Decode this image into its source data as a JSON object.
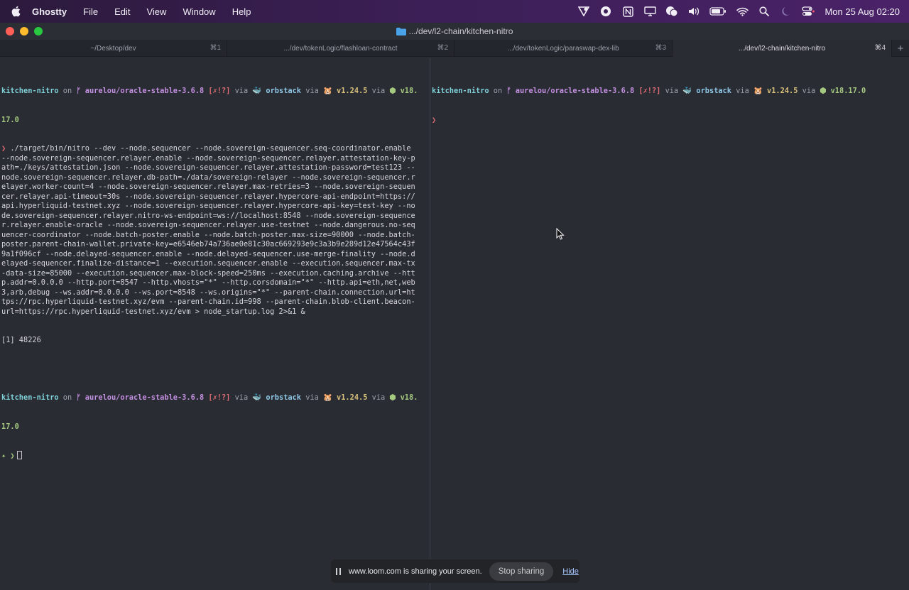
{
  "menubar": {
    "app": "Ghostty",
    "items": [
      "File",
      "Edit",
      "View",
      "Window",
      "Help"
    ],
    "status_icons": [
      "vpn-icon",
      "record-icon",
      "notion-icon",
      "display-icon",
      "chat-icon",
      "volume-icon",
      "battery-icon",
      "wifi-icon",
      "search-icon",
      "focus-moon-icon",
      "control-center-icon"
    ],
    "clock": "Mon 25 Aug  02:20"
  },
  "window": {
    "title": ".../dev/l2-chain/kitchen-nitro",
    "tabs": [
      {
        "label": "~/Desktop/dev",
        "shortcut": "⌘1"
      },
      {
        "label": ".../dev/tokenLogic/flashloan-contract",
        "shortcut": "⌘2"
      },
      {
        "label": ".../dev/tokenLogic/paraswap-dex-lib",
        "shortcut": "⌘3"
      },
      {
        "label": ".../dev/l2-chain/kitchen-nitro",
        "shortcut": "⌘4"
      }
    ],
    "add_tab": "+"
  },
  "left_pane": {
    "prompt1": {
      "dir": "kitchen-nitro",
      "on": " on ",
      "branch": "ᚠ aurelou/oracle-stable-3.6.8",
      "status": " [✗!?]",
      "via1": " via ",
      "tool1": "🐳 orbstack",
      "via2": " via ",
      "tool2": "🐹 v1.24.5",
      "via3": " via ",
      "node": "⬢ v18.",
      "node_wrap": "17.0"
    },
    "command_lines": [
      "❯ ./target/bin/nitro --dev --node.sequencer --node.sovereign-sequencer.seq-coordinator.enable",
      "--node.sovereign-sequencer.relayer.enable --node.sovereign-sequencer.relayer.attestation-key-p",
      "ath=./keys/attestation.json --node.sovereign-sequencer.relayer.attestation-password=test123 --",
      "node.sovereign-sequencer.relayer.db-path=./data/sovereign-relayer --node.sovereign-sequencer.r",
      "elayer.worker-count=4 --node.sovereign-sequencer.relayer.max-retries=3 --node.sovereign-sequen",
      "cer.relayer.api-timeout=30s --node.sovereign-sequencer.relayer.hypercore-api-endpoint=https://",
      "api.hyperliquid-testnet.xyz --node.sovereign-sequencer.relayer.hypercore-api-key=test-key --no",
      "de.sovereign-sequencer.relayer.nitro-ws-endpoint=ws://localhost:8548 --node.sovereign-sequence",
      "r.relayer.enable-oracle --node.sovereign-sequencer.relayer.use-testnet --node.dangerous.no-seq",
      "uencer-coordinator --node.batch-poster.enable --node.batch-poster.max-size=90000 --node.batch-",
      "poster.parent-chain-wallet.private-key=e6546eb74a736ae0e81c30ac669293e9c3a3b9e289d12e47564c43f",
      "9a1f096cf --node.delayed-sequencer.enable --node.delayed-sequencer.use-merge-finality --node.d",
      "elayed-sequencer.finalize-distance=1 --execution.sequencer.enable --execution.sequencer.max-tx",
      "-data-size=85000 --execution.sequencer.max-block-speed=250ms --execution.caching.archive --htt",
      "p.addr=0.0.0.0 --http.port=8547 --http.vhosts=\"*\" --http.corsdomain=\"*\" --http.api=eth,net,web",
      "3,arb,debug --ws.addr=0.0.0.0 --ws.port=8548 --ws.origins=\"*\" --parent-chain.connection.url=ht",
      "tps://rpc.hyperliquid-testnet.xyz/evm --parent-chain.id=998 --parent-chain.blob-client.beacon-",
      "url=https://rpc.hyperliquid-testnet.xyz/evm > node_startup.log 2>&1 &"
    ],
    "job_line": "[1] 48226",
    "final_prompt": "✦ ❯"
  },
  "right_pane": {
    "prompt": {
      "dir": "kitchen-nitro",
      "on": " on ",
      "branch": "ᚠ aurelou/oracle-stable-3.6.8",
      "status": " [✗!?]",
      "via1": " via ",
      "tool1": "🐳 orbstack",
      "via2": " via ",
      "tool2": "🐹 v1.24.5",
      "via3": " via ",
      "node": "⬢ v18.17.0"
    },
    "prompt_char": "❯"
  },
  "loom": {
    "message": "www.loom.com is sharing your screen.",
    "stop_label": "Stop sharing",
    "hide_label": "Hide"
  },
  "colors": {
    "terminal_bg": "#292c33",
    "dir": "#7fd0d8",
    "branch": "#c38fe0",
    "status": "#e06c75",
    "node": "#a5c97f"
  }
}
